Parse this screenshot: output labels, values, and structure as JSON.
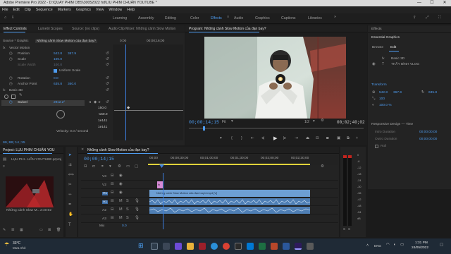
{
  "window": {
    "title": "Adobe Premiere Pro 2022 - D:\\QUAY PHIM OBS\\30052022 hd\\LIU PHIM CHUẨN YOUTUBE *",
    "minimize": "—",
    "maximize": "☐",
    "close": "✕"
  },
  "menu": [
    "File",
    "Edit",
    "Clip",
    "Sequence",
    "Markers",
    "Graphics",
    "View",
    "Window",
    "Help"
  ],
  "workspaces": [
    "Learning",
    "Assembly",
    "Editing",
    "Color",
    "Effects",
    "Audio",
    "Graphics",
    "Captions",
    "Libraries"
  ],
  "active_workspace": "Effects",
  "effect_controls": {
    "tabs": [
      "Effect Controls",
      "Lumetri Scopes",
      "Source: (no clips)",
      "Audio Clip Mixer: Những cảnh Slow Motion"
    ],
    "source_label": "Source * Graphic",
    "source_clip": "Những cảnh Slow Motion của đạn bay?",
    "time_start": "0:00",
    "time_end": "00;00;16;00",
    "section_vector": "Vector Motion",
    "position_label": "Position",
    "position_x": "542.8",
    "position_y": "367.9",
    "scale_label": "Scale",
    "scale_val": "100.0",
    "scale_width_label": "Scale Width",
    "scale_width_val": "100.0",
    "uniform_scale": "Uniform Scale",
    "rotation_label": "Rotation",
    "rotation_val": "0.0",
    "anchor_label": "Anchor Point",
    "anchor_x": "635.8",
    "anchor_y": "360.0",
    "section_basic3d": "Basic 3D",
    "swivel_label": "Swivel",
    "swivel_val": "29x2.2°",
    "graph_val_1": "150.0",
    "graph_val_2": "-150.0",
    "graph_val_3": "1e141",
    "graph_val_4": "1e141",
    "velocity": "Velocity: 0.0 / second",
    "timecode": "00;00;14;15"
  },
  "program": {
    "title": "Program: Những cảnh Slow Motion của đạn bay?",
    "timecode": "00;00;14;15",
    "fit": "Fit",
    "fraction": "1/2",
    "duration": "00;02;40;02"
  },
  "right_panel": {
    "tab_effects": "Effects",
    "essential_graphics": "Essential Graphics",
    "browse": "Browse",
    "edit": "Edit",
    "layer_basic3d": "Basic 3D",
    "layer_name": "THẦY BÌNH VLOG",
    "transform": "Transform",
    "t_x": "542.8",
    "t_y": "367.9",
    "t_rot": "635.8",
    "t_scale": "100",
    "t_opacity": "100.0 %",
    "responsive": "Responsive Design — Time",
    "intro": "Intro Duration",
    "intro_val": "00;00;00;00",
    "outro": "Outro Duration",
    "outro_val": "00;00;00;00",
    "roll": "Roll"
  },
  "project": {
    "tabs": [
      "Project: LỤU PHIM CHUẨN YOU",
      ""
    ],
    "file": "LỤU PHI...UẨN YOUTUBE.prproj",
    "clip_name": "Những cảnh Slow M...",
    "clip_duration": "2:40:02"
  },
  "timeline": {
    "title": "Những cảnh Slow Motion của đạn bay?",
    "timecode": "00;00;14;15",
    "ruler": [
      "00;00",
      "00;00;30;00",
      "00;01;00;00",
      "00;01;30;00",
      "00;02;00;00",
      "00;02;30;00"
    ],
    "tracks": [
      "V3",
      "V2",
      "V1",
      "A1",
      "A2",
      "A3",
      "Mix"
    ],
    "mix_val": "0.0",
    "clip_v1": "Những cảnh Slow Motion của đạn bay/4.mp4 [V]",
    "clip_v2": "fx"
  },
  "audio_meter": [
    "0",
    "-6",
    "-12",
    "-18",
    "-24",
    "-30",
    "-36",
    "-42",
    "-48",
    "-54",
    "dB"
  ],
  "audio_meter_solo": [
    "S",
    "S"
  ],
  "taskbar": {
    "weather_temp": "33°C",
    "weather_desc": "Mưa nhỏ",
    "lang": "ENG",
    "time": "1:31 PM",
    "date": "24/05/2022"
  },
  "colors": {
    "accent": "#4e9cf0",
    "track_video": "#6d9fd4",
    "track_audio": "#4f7fb5",
    "playhead": "#3c7fe0"
  }
}
